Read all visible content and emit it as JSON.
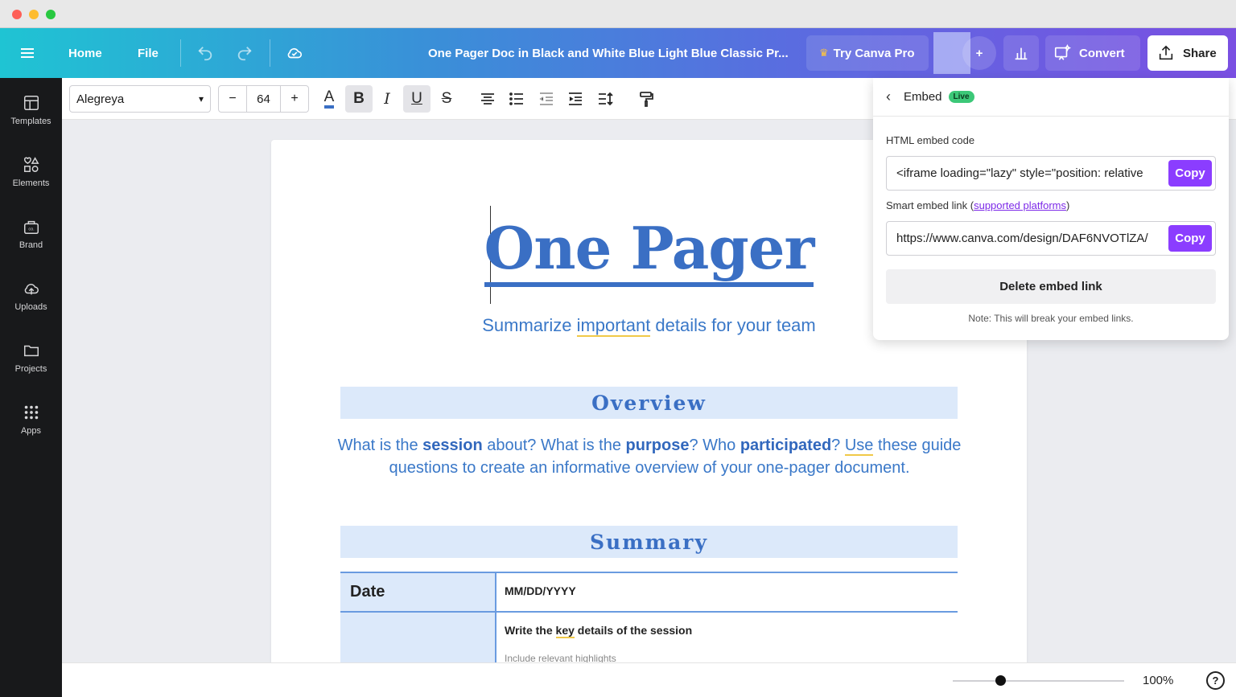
{
  "topbar": {
    "home_label": "Home",
    "file_label": "File",
    "doc_title": "One Pager Doc in Black and White Blue Light Blue Classic Pr...",
    "try_pro_label": "Try Canva Pro",
    "convert_label": "Convert",
    "share_label": "Share"
  },
  "sidebar": {
    "items": [
      {
        "label": "Templates",
        "icon": "templates-icon"
      },
      {
        "label": "Elements",
        "icon": "elements-icon"
      },
      {
        "label": "Brand",
        "icon": "brand-icon"
      },
      {
        "label": "Uploads",
        "icon": "uploads-icon"
      },
      {
        "label": "Projects",
        "icon": "folder-icon"
      },
      {
        "label": "Apps",
        "icon": "apps-grid-icon"
      }
    ]
  },
  "toolbar": {
    "font_name": "Alegreya",
    "font_size": "64",
    "minus": "−",
    "plus": "+"
  },
  "document": {
    "heading": "One Pager",
    "subtitle_pre": "Summarize ",
    "subtitle_hl": "important",
    "subtitle_post": " details for your team",
    "overview_title": "Overview",
    "overview_text": {
      "p1": "What is the ",
      "b1": "session",
      "p2": " about? What is the ",
      "b2": "purpose",
      "p3": "? Who ",
      "b3": "participated",
      "p4": "? ",
      "u1": "Use",
      "p5": " these guide questions to create an informative overview of your one-pager document."
    },
    "summary_title": "Summary",
    "table": {
      "date_label": "Date",
      "date_value": "MM/DD/YYYY",
      "details_pre": "Write the ",
      "details_key": "key",
      "details_post": " details of the session",
      "details_faded": "Include relevant highlights"
    }
  },
  "embed_panel": {
    "title": "Embed",
    "badge": "Live",
    "html_label": "HTML embed code",
    "html_value": "<iframe loading=\"lazy\" style=\"position: relative",
    "copy_label": "Copy",
    "smart_label_pre": "Smart embed link (",
    "smart_label_link": "supported platforms",
    "smart_label_post": ")",
    "smart_value": "https://www.canva.com/design/DAF6NVOTlZA/",
    "delete_label": "Delete embed link",
    "note": "Note: This will break your embed links."
  },
  "footer": {
    "zoom": "100%",
    "zoom_level": 0.28,
    "help": "?"
  },
  "colors": {
    "accent_purple": "#8b3dff",
    "doc_blue": "#3a6fc4",
    "band_blue": "#dce9fa",
    "live_green": "#3cc878"
  }
}
